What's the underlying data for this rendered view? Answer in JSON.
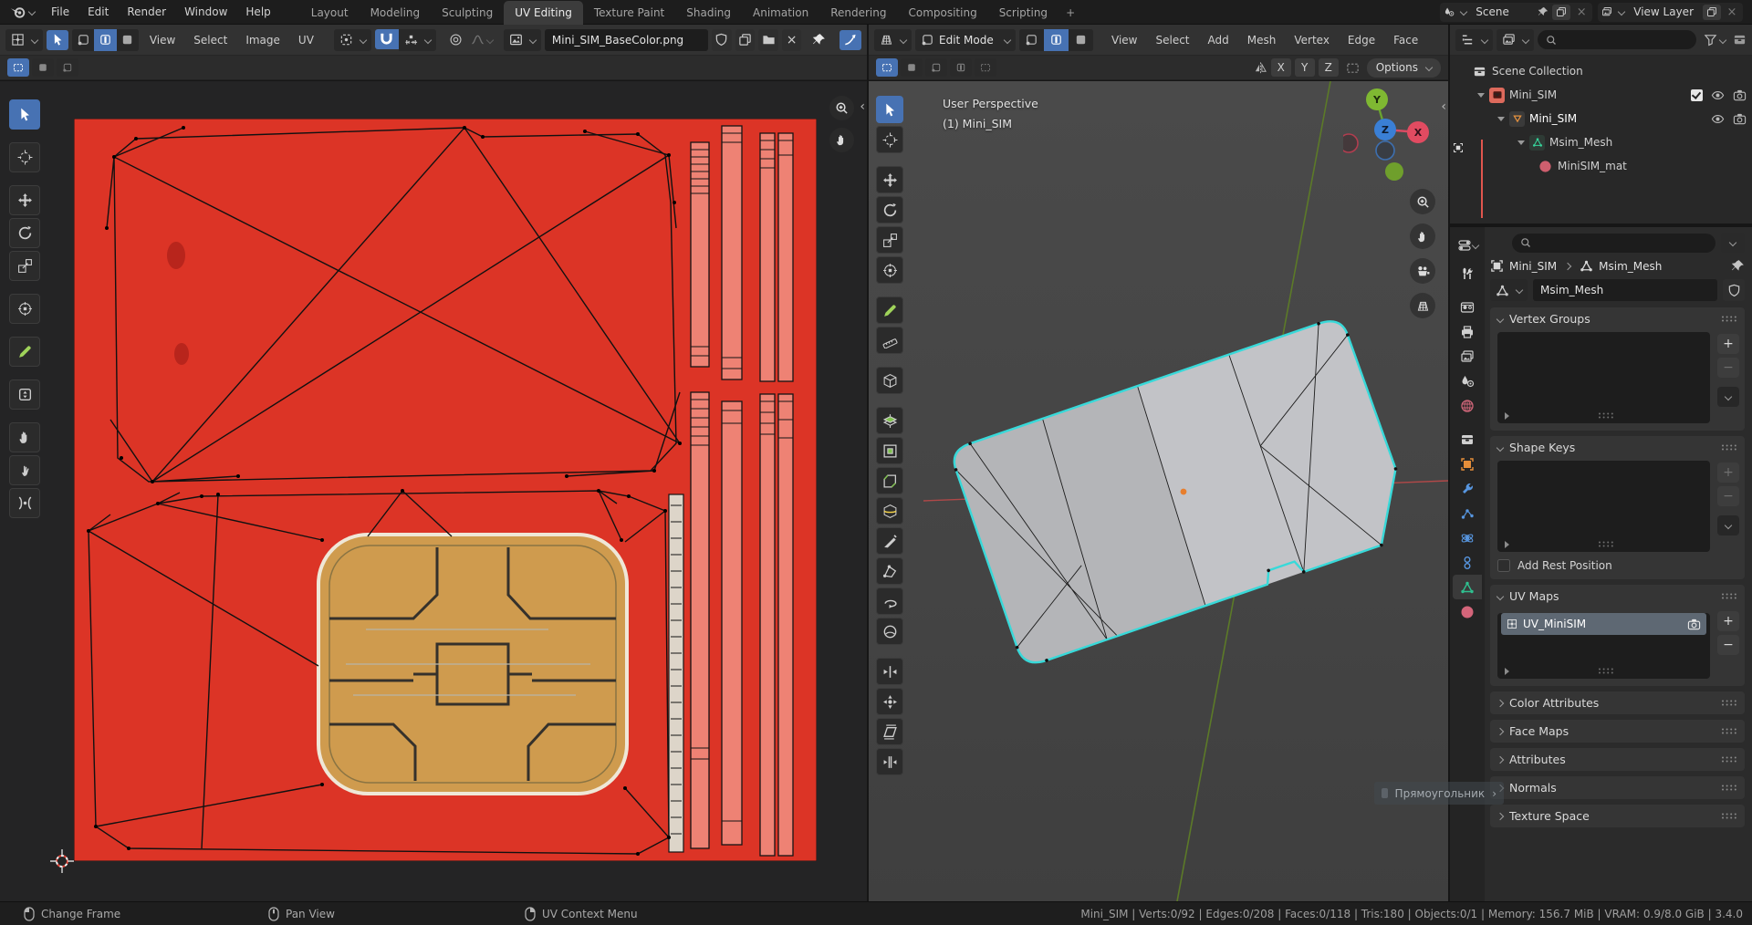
{
  "topbar": {
    "menus": [
      "File",
      "Edit",
      "Render",
      "Window",
      "Help"
    ],
    "workspaces": [
      "Layout",
      "Modeling",
      "Sculpting",
      "UV Editing",
      "Texture Paint",
      "Shading",
      "Animation",
      "Rendering",
      "Compositing",
      "Scripting"
    ],
    "add_workspace": "+",
    "scene_label": "Scene",
    "view_layer_label": "View Layer"
  },
  "uv_editor": {
    "menus": [
      "View",
      "Select",
      "Image",
      "UV"
    ],
    "image_name": "Mini_SIM_BaseColor.png",
    "tools": [
      "tweak-select",
      "cursor-2d",
      "move",
      "rotate",
      "scale",
      "transform",
      "annotate",
      "measure",
      "grab",
      "relax",
      "pinch"
    ]
  },
  "viewport": {
    "mode": "Edit Mode",
    "menus": [
      "View",
      "Select",
      "Add",
      "Mesh",
      "Vertex",
      "Edge",
      "Face"
    ],
    "axes": [
      "X",
      "Y",
      "Z"
    ],
    "options": "Options",
    "overlay": {
      "line1": "User Perspective",
      "line2": "(1) Mini_SIM"
    },
    "gizmo": {
      "x": "X",
      "y": "Y",
      "z": "Z"
    },
    "tools": [
      "tweak-select",
      "cursor-3d",
      "move",
      "rotate",
      "scale",
      "transform",
      "annotate",
      "measure",
      "add-cube",
      "extrude-region",
      "inset-faces",
      "bevel",
      "loop-cut",
      "knife",
      "poly-build",
      "spin",
      "smooth",
      "edge-slide",
      "shrink-fatten",
      "shear",
      "rip-region"
    ]
  },
  "outliner": {
    "rows": [
      {
        "label": "Scene Collection"
      },
      {
        "label": "Mini_SIM"
      },
      {
        "label": "Mini_SIM"
      },
      {
        "label": "Msim_Mesh"
      },
      {
        "label": "MiniSIM_mat"
      }
    ]
  },
  "properties": {
    "breadcrumb_object": "Mini_SIM",
    "breadcrumb_data": "Msim_Mesh",
    "mesh_name": "Msim_Mesh",
    "uv_map_name": "UV_MiniSIM",
    "panels": {
      "vertex_groups": "Vertex Groups",
      "shape_keys": "Shape Keys",
      "add_rest_position": "Add Rest Position",
      "uv_maps": "UV Maps",
      "color_attributes": "Color Attributes",
      "face_maps": "Face Maps",
      "attributes": "Attributes",
      "normals": "Normals",
      "texture_space": "Texture Space"
    }
  },
  "ghost_menu": {
    "label": "Прямоугольник"
  },
  "status_bar": {
    "hints": [
      "Change Frame",
      "Pan View",
      "UV Context Menu"
    ],
    "stats": "Mini_SIM | Verts:0/92 | Edges:0/208 | Faces:0/118 | Tris:180 | Objects:0/1 | Memory: 156.7 MiB | VRAM: 0.9/8.0 GiB | 3.4.0"
  },
  "colors": {
    "accent_blue": "#4772b3",
    "selection_cyan": "#38d9d9",
    "texture_red": "#dc3426",
    "strip_pink": "#ee8274",
    "chip_gold": "#cf9b4e",
    "axis_green": "#5c7a28",
    "axis_red": "#b04848"
  }
}
